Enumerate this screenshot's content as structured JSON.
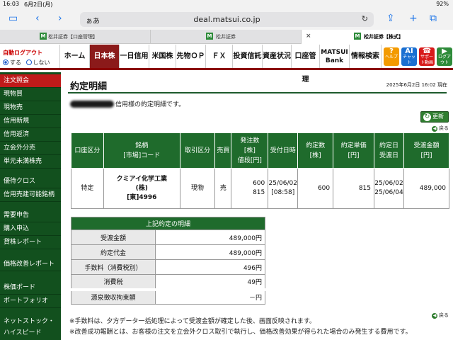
{
  "status": {
    "time": "16:03",
    "date": "6月2日(月)",
    "battery": "92%"
  },
  "browser": {
    "aa": "ぁあ",
    "url": "deal.matsui.co.jp",
    "tabs": [
      {
        "label": "松井証券【口座管理】"
      },
      {
        "label": "松井証券"
      },
      {
        "label": "松井証券【株式】"
      }
    ]
  },
  "nav": {
    "auto_logout": "自動ログアウト",
    "on": "する",
    "off": "しない",
    "items": [
      "ホーム",
      "日本株",
      "一日信用",
      "米国株",
      "先物ＯＰ",
      "ＦＸ",
      "投資信託",
      "資産状況",
      "口座管理",
      "MATSUI",
      "Bank",
      "情報検索"
    ],
    "help": [
      {
        "sym": "?",
        "label": "ヘルプ",
        "color": "#f39a00"
      },
      {
        "sym": "AI",
        "label": "チャット",
        "color": "#1a6fd1"
      },
      {
        "sym": "☎",
        "label": "サポート動画",
        "color": "#d81b1b"
      },
      {
        "sym": "▶",
        "label": "ログアウト",
        "color": "#2e8b3a"
      }
    ]
  },
  "sidebar": {
    "items": [
      "注文照会",
      "現物買",
      "現物売",
      "信用新規",
      "信用返済",
      "立会外分売",
      "単元未満株売",
      "",
      "優待クロス",
      "信用売建可能銘柄",
      "",
      "需要申告",
      "購入申込",
      "貸株レポート",
      "",
      "価格改善レポート",
      "",
      "株価ボード",
      "ポートフォリオ",
      "",
      "ネットストック・",
      "ハイスピード"
    ]
  },
  "main": {
    "title": "約定明細",
    "datetime": "2025年6月2日 16:02 現在",
    "message": "信用様の約定明細です。",
    "refresh": "更新",
    "back": "戻る",
    "table": {
      "headers": [
        "口座区分",
        "銘柄\n[市場]コード",
        "取引区分",
        "売買",
        "発注数\n[株]\n値段[円]",
        "受付日時",
        "約定数\n[株]",
        "約定単価\n[円]",
        "約定日\n受渡日",
        "受渡金額\n[円]"
      ],
      "row": {
        "account": "特定",
        "name": "クミアイ化学工業\n(株)\n[東]4996",
        "type": "現物",
        "side": "売",
        "order": "600\n815",
        "received": "25/06/02\n[08:58]",
        "qty": "600",
        "price": "815",
        "dates": "25/06/02\n25/06/04",
        "amount": "489,000"
      }
    },
    "detail": {
      "head": "上記約定の明細",
      "rows": [
        {
          "label": "受渡金額",
          "value": "489,000円"
        },
        {
          "label": "約定代金",
          "value": "489,000円"
        },
        {
          "label": "手数料（消費税別）",
          "value": "496円"
        },
        {
          "label": "消費税",
          "value": "49円"
        },
        {
          "label": "源泉徴収拘束額",
          "value": "－円"
        }
      ]
    },
    "notes": [
      "※手数料は、夕方データ一括処理によって受渡金額が確定した後、画面反映されます。",
      "※改善成功報酬とは、お客様の注文を立会外クロス取引で執行し、価格改善効果が得られた場合のみ発生する費用です。"
    ]
  }
}
